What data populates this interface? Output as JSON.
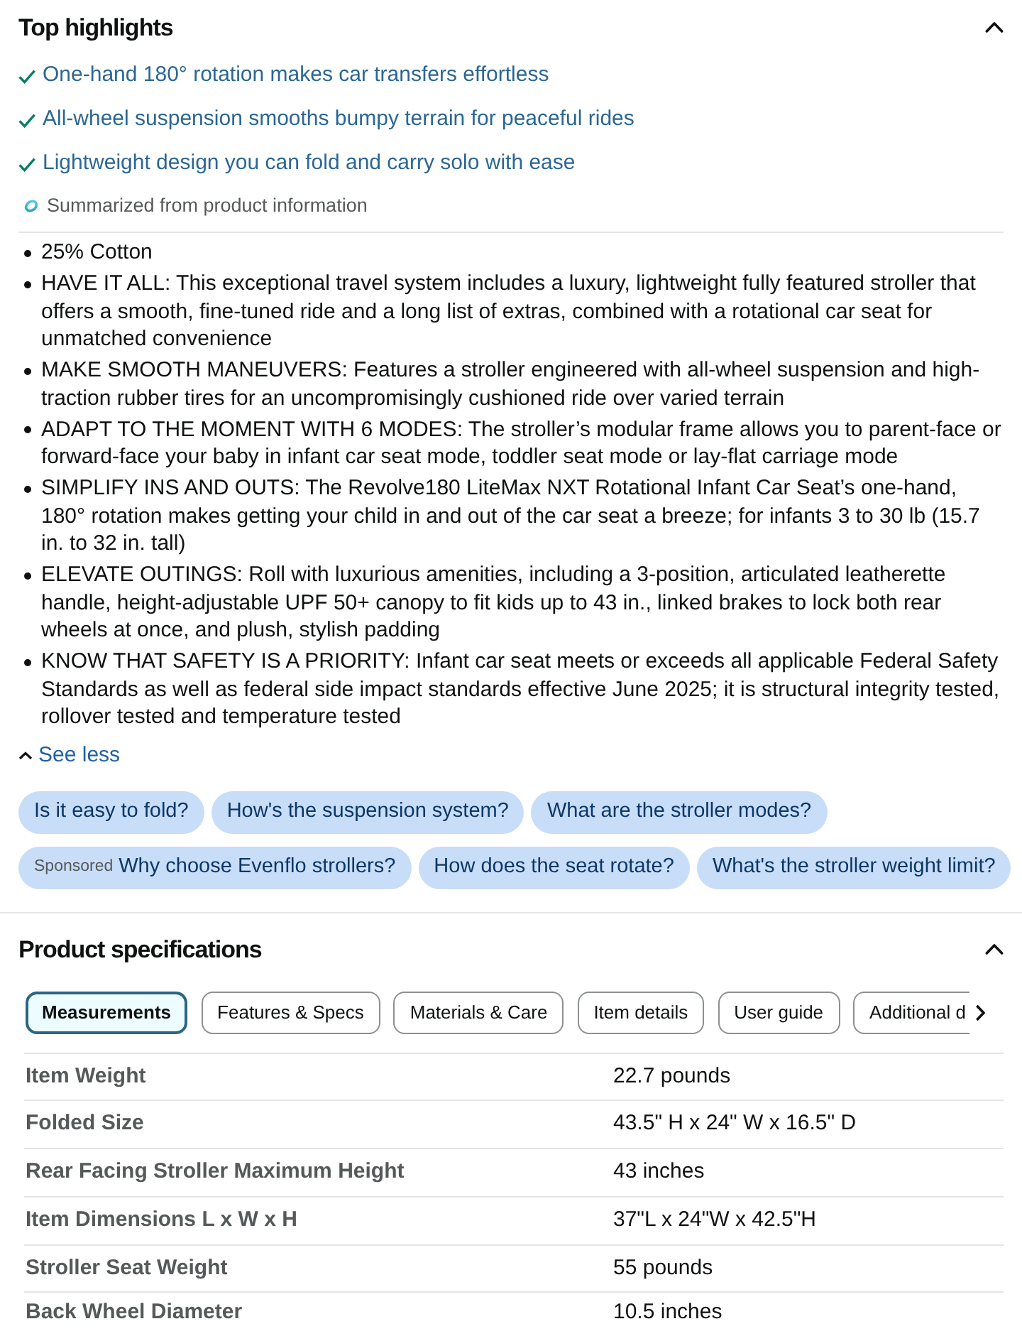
{
  "top_highlights": {
    "title": "Top highlights",
    "expanded": true,
    "highlights": [
      "One-hand 180° rotation makes car transfers effortless",
      "All-wheel suspension smooths bumpy terrain for peaceful rides",
      "Lightweight design you can fold and carry solo with ease"
    ],
    "source_note": "Summarized from product information"
  },
  "feature_bullets": [
    "25% Cotton",
    "HAVE IT ALL: This exceptional travel system includes a luxury, lightweight fully featured stroller that offers a smooth, fine-tuned ride and a long list of extras, combined with a rotational car seat for unmatched convenience",
    "MAKE SMOOTH MANEUVERS: Features a stroller engineered with all-wheel suspension and high-traction rubber tires for an uncompromisingly cushioned ride over varied terrain",
    "ADAPT TO THE MOMENT WITH 6 MODES: The stroller’s modular frame allows you to parent-face or forward-face your baby in infant car seat mode, toddler seat mode or lay-flat carriage mode",
    "SIMPLIFY INS AND OUTS: The Revolve180 LiteMax NXT Rotational Infant Car Seat’s one-hand, 180° rotation makes getting your child in and out of the car seat a breeze; for infants 3 to 30 lb (15.7 in. to 32 in. tall)",
    "ELEVATE OUTINGS: Roll with luxurious amenities, including a 3-position, articulated leatherette handle, height-adjustable UPF 50+ canopy to fit kids up to 43 in., linked brakes to lock both rear wheels at once, and plush, stylish padding",
    "KNOW THAT SAFETY IS A PRIORITY: Infant car seat meets or exceeds all applicable Federal Safety Standards as well as federal side impact standards effective June 2025; it is structural integrity tested, rollover tested and temperature tested"
  ],
  "see_less": {
    "label": "See less"
  },
  "suggested_questions": [
    [
      {
        "text": "Is it easy to fold?"
      },
      {
        "text": "How's the suspension system?"
      },
      {
        "text": "What are the stroller modes?"
      }
    ],
    [
      {
        "tag": "Sponsored",
        "text": "Why choose Evenflo strollers?"
      },
      {
        "text": "How does the seat rotate?"
      },
      {
        "text": "What's the stroller weight limit?"
      }
    ]
  ],
  "product_specifications": {
    "title": "Product specifications",
    "expanded": true,
    "tabs": [
      {
        "label": "Measurements",
        "selected": true
      },
      {
        "label": "Features & Specs",
        "selected": false
      },
      {
        "label": "Materials & Care",
        "selected": false
      },
      {
        "label": "Item details",
        "selected": false
      },
      {
        "label": "User guide",
        "selected": false
      },
      {
        "label": "Additional d",
        "selected": false
      }
    ],
    "rows": [
      {
        "name": "Item Weight",
        "value": "22.7 pounds"
      },
      {
        "name": "Folded Size",
        "value": "43.5\" H x 24\" W x 16.5\" D"
      },
      {
        "name": "Rear Facing Stroller Maximum Height",
        "value": "43 inches"
      },
      {
        "name": "Item Dimensions L x W x H",
        "value": "37\"L x 24\"W x 42.5\"H"
      },
      {
        "name": "Stroller Seat Weight",
        "value": "55 pounds"
      },
      {
        "name": "Back Wheel Diameter",
        "value": "10.5 inches"
      }
    ]
  }
}
